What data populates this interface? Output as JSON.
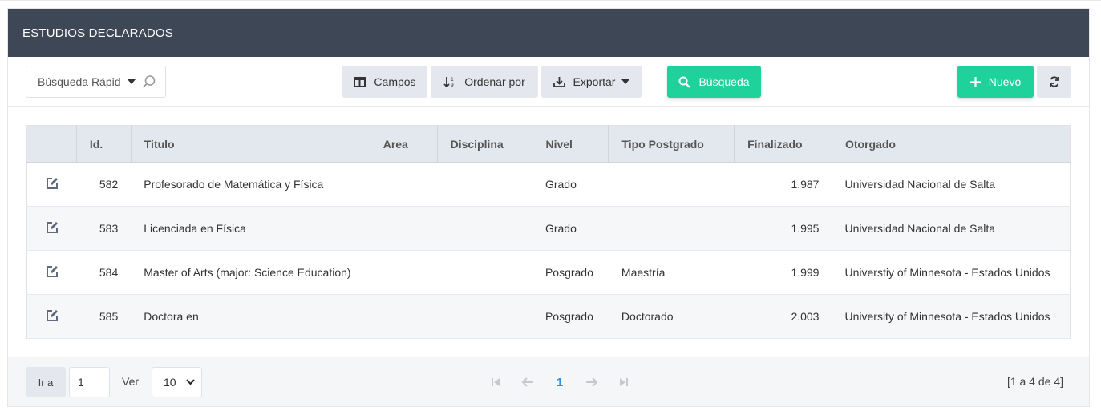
{
  "panel": {
    "title": "ESTUDIOS DECLARADOS"
  },
  "toolbar": {
    "quick_search_placeholder": "Búsqueda Rápida",
    "fields_label": "Campos",
    "sort_label": "Ordenar por",
    "export_label": "Exportar",
    "search_label": "Búsqueda",
    "new_label": "Nuevo"
  },
  "colors": {
    "header_bg": "#3d4756",
    "accent_green": "#1fd19a",
    "link_blue": "#2a8fe0"
  },
  "table": {
    "columns": [
      "Id.",
      "Titulo",
      "Area",
      "Disciplina",
      "Nivel",
      "Tipo Postgrado",
      "Finalizado",
      "Otorgado"
    ],
    "rows": [
      {
        "id": "582",
        "titulo": "Profesorado de Matemática y Física",
        "area": "",
        "disciplina": "",
        "nivel": "Grado",
        "tipo": "",
        "finalizado": "1.987",
        "otorgado": "Universidad Nacional de Salta"
      },
      {
        "id": "583",
        "titulo": "Licenciada en Física",
        "area": "",
        "disciplina": "",
        "nivel": "Grado",
        "tipo": "",
        "finalizado": "1.995",
        "otorgado": "Universidad Nacional de Salta"
      },
      {
        "id": "584",
        "titulo": "Master of Arts (major: Science Education)",
        "area": "",
        "disciplina": "",
        "nivel": "Posgrado",
        "tipo": "Maestría",
        "finalizado": "1.999",
        "otorgado": "Universtiy of Minnesota - Estados Unidos"
      },
      {
        "id": "585",
        "titulo": "Doctora en",
        "area": "",
        "disciplina": "",
        "nivel": "Posgrado",
        "tipo": "Doctorado",
        "finalizado": "2.003",
        "otorgado": "University of Minnesota - Estados Unidos"
      }
    ]
  },
  "footer": {
    "goto_label": "Ir a",
    "page_value": "1",
    "view_label": "Ver",
    "page_size": "10",
    "current_page": "1",
    "summary": "[1 a 4 de 4]"
  },
  "icons": [
    "search-icon",
    "columns-icon",
    "sort-icon",
    "download-icon",
    "plus-icon",
    "refresh-icon",
    "edit-icon",
    "first-page-icon",
    "prev-page-icon",
    "next-page-icon",
    "last-page-icon"
  ]
}
